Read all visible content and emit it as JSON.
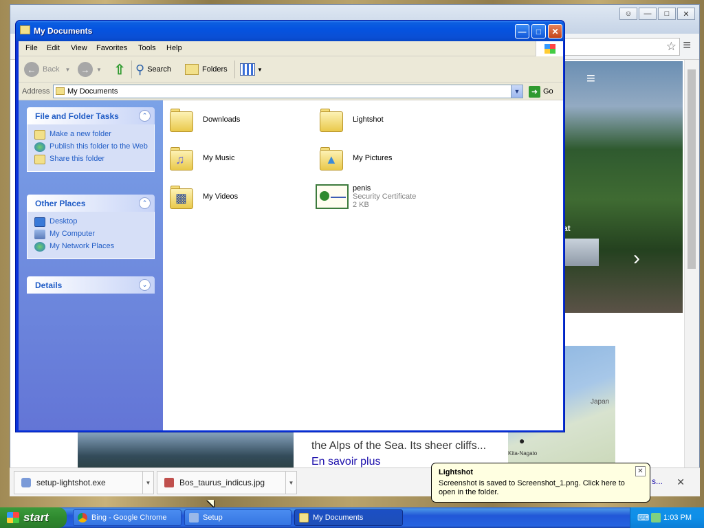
{
  "explorer": {
    "title": "My Documents",
    "menu": [
      "File",
      "Edit",
      "View",
      "Favorites",
      "Tools",
      "Help"
    ],
    "toolbar": {
      "back": "Back",
      "search": "Search",
      "folders": "Folders"
    },
    "address": {
      "label": "Address",
      "value": "My Documents",
      "go": "Go"
    },
    "tasks": {
      "file_folder_tasks": {
        "title": "File and Folder Tasks",
        "items": [
          "Make a new folder",
          "Publish this folder to the Web",
          "Share this folder"
        ]
      },
      "other_places": {
        "title": "Other Places",
        "items": [
          "Desktop",
          "My Computer",
          "My Network Places"
        ]
      },
      "details": {
        "title": "Details"
      }
    },
    "files": [
      {
        "name": "Downloads"
      },
      {
        "name": "Lightshot"
      },
      {
        "name": "My Music"
      },
      {
        "name": "My Pictures"
      },
      {
        "name": "My Videos"
      },
      {
        "name": "penis",
        "type": "Security Certificate",
        "size": "2 KB"
      }
    ]
  },
  "chrome": {
    "article_text": "the Alps of the Sea. Its sheer cliffs...",
    "article_link": "En savoir plus",
    "hero_text": "at",
    "map_label_country": "Japan",
    "map_label_city": "Kita-Nagato"
  },
  "downloads": {
    "items": [
      "setup-lightshot.exe",
      "Bos_taurus_indicus.jpg"
    ],
    "more": "s..."
  },
  "taskbar": {
    "start": "start",
    "buttons": [
      "Bing - Google Chrome",
      "Setup",
      "My Documents"
    ],
    "clock": "1:03 PM"
  },
  "balloon": {
    "title": "Lightshot",
    "body": "Screenshot is saved to Screenshot_1.png. Click here to open in the folder."
  }
}
